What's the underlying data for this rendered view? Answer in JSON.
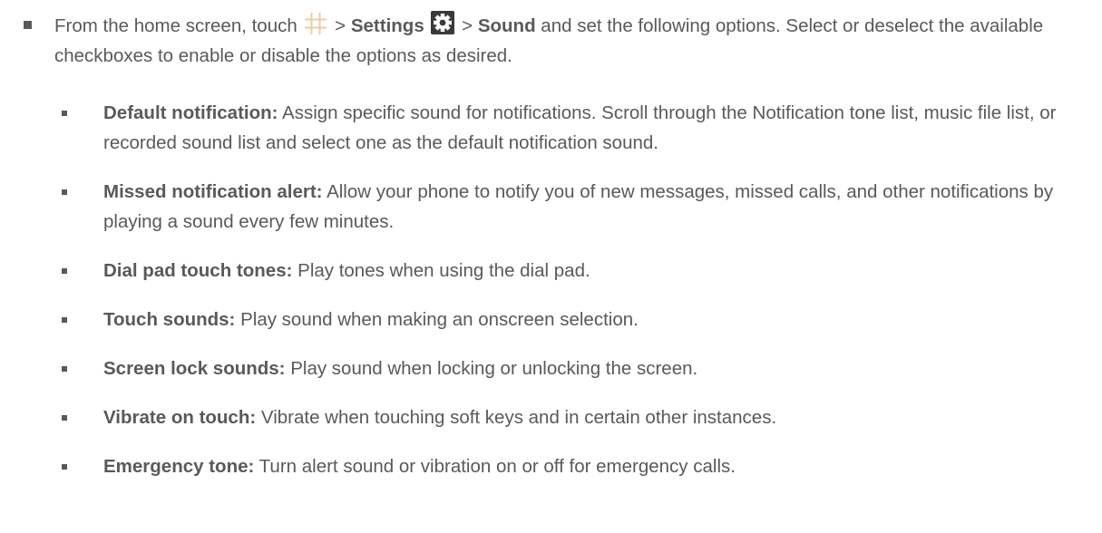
{
  "intro": {
    "prefix": "From the home screen, touch",
    "sep1": ">",
    "settings_label": "Settings",
    "sep2": ">",
    "sound_label": "Sound",
    "suffix": "and set the following options. Select or deselect the available checkboxes to enable or disable the options as desired.",
    "apps_icon": "apps-grid-icon",
    "settings_icon": "gear-icon"
  },
  "options": [
    {
      "term": "Default notification:",
      "description": "Assign specific sound for notifications. Scroll through the Notification tone list, music file list, or recorded sound list and select one as the default notification sound."
    },
    {
      "term": "Missed notification alert:",
      "description": "Allow your phone to notify you of new messages, missed calls, and other notifications by playing a sound every few minutes."
    },
    {
      "term": "Dial pad touch tones:",
      "description": "Play tones when using the dial pad."
    },
    {
      "term": "Touch sounds:",
      "description": "Play sound when making an onscreen selection."
    },
    {
      "term": "Screen lock sounds:",
      "description": "Play sound when locking or unlocking the screen."
    },
    {
      "term": "Vibrate on touch:",
      "description": "Vibrate when touching soft keys and in certain other instances."
    },
    {
      "term": "Emergency tone:",
      "description": "Turn alert sound or vibration on or off for emergency calls."
    }
  ],
  "colors": {
    "text": "#595959",
    "grid_icon": "#f2c9a6",
    "gear_bg": "#3a3a3a"
  }
}
